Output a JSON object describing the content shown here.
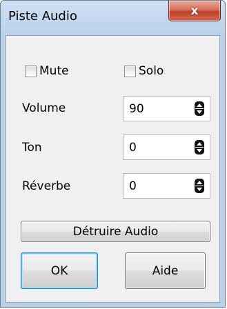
{
  "window": {
    "title": "Piste Audio",
    "close_glyph": "x"
  },
  "checkboxes": {
    "mute": {
      "label": "Mute",
      "checked": false
    },
    "solo": {
      "label": "Solo",
      "checked": false
    }
  },
  "fields": {
    "volume": {
      "label": "Volume",
      "value": "90"
    },
    "ton": {
      "label": "Ton",
      "value": "0"
    },
    "reverbe": {
      "label": "Réverbe",
      "value": "0"
    }
  },
  "buttons": {
    "detruire": "Détruire Audio",
    "ok": "OK",
    "aide": "Aide"
  },
  "colors": {
    "frame": "#b9d1ea",
    "close": "#c1412a",
    "default_button_border": "#3c7fb1"
  }
}
